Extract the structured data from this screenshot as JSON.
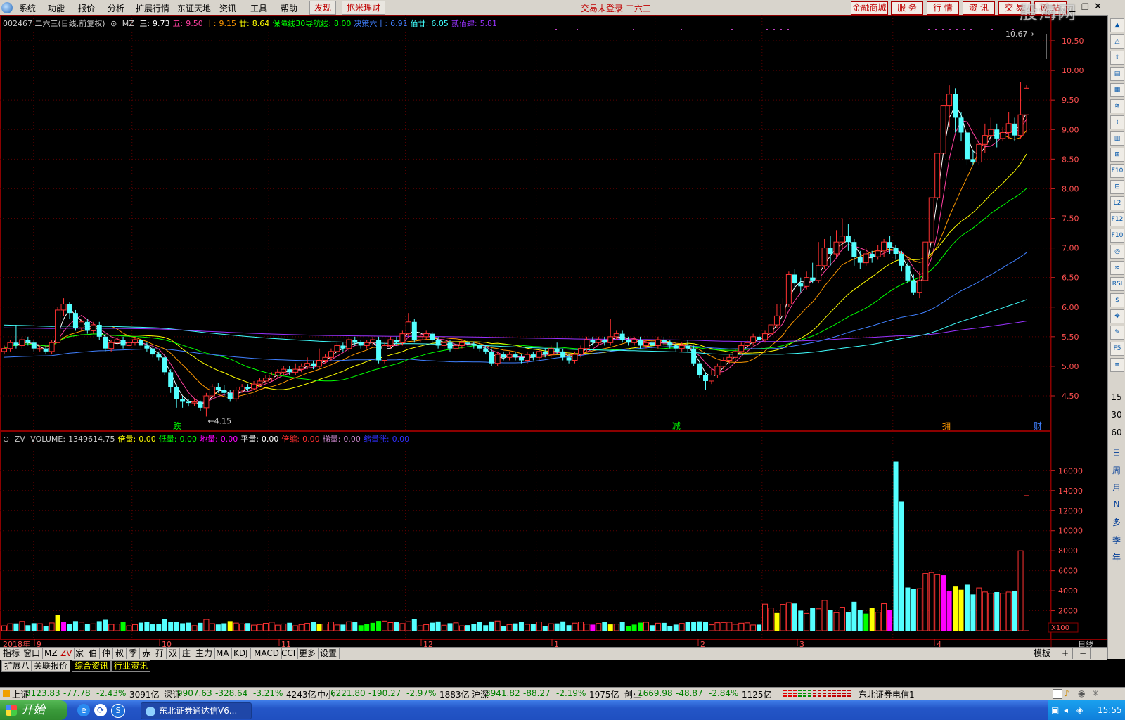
{
  "menubar": {
    "items": [
      "系统",
      "功能",
      "报价",
      "分析",
      "扩展行情",
      "东证天地",
      "资讯",
      "工具",
      "帮助"
    ],
    "highlight_items": [
      "发现",
      "抱米理财"
    ],
    "center_text": "交易未登录  二六三",
    "right_buttons": [
      "金融商城",
      "服 务",
      "行 情",
      "资 讯",
      "交 易",
      "网 站"
    ],
    "watermark": "股海网"
  },
  "price_info": {
    "code_name": "002467 二六三(日线,前复权)",
    "mz_label": "MZ",
    "items": [
      {
        "label": "三:",
        "value": "9.73",
        "color": "#ffffff"
      },
      {
        "label": "五:",
        "value": "9.50",
        "color": "#ff40a0"
      },
      {
        "label": "十:",
        "value": "9.15",
        "color": "#ff9900"
      },
      {
        "label": "廿:",
        "value": "8.64",
        "color": "#ffff00"
      },
      {
        "label": "保障线30导航线:",
        "value": "8.00",
        "color": "#00ff00"
      },
      {
        "label": "决策六十:",
        "value": "6.91",
        "color": "#4080ff"
      },
      {
        "label": "佰廿:",
        "value": "6.05",
        "color": "#40ffff"
      },
      {
        "label": "贰佰肆:",
        "value": "5.81",
        "color": "#9933ff"
      }
    ]
  },
  "volume_info": {
    "indicator": "ZV",
    "items": [
      {
        "label": "VOLUME:",
        "value": "1349614.75",
        "color": "#cccccc"
      },
      {
        "label": "倍量:",
        "value": "0.00",
        "color": "#ffff00"
      },
      {
        "label": "低量:",
        "value": "0.00",
        "color": "#00ff00"
      },
      {
        "label": "地量:",
        "value": "0.00",
        "color": "#ff00ff"
      },
      {
        "label": "平量:",
        "value": "0.00",
        "color": "#ffffff"
      },
      {
        "label": "倍缩:",
        "value": "0.00",
        "color": "#ff3030"
      },
      {
        "label": "梯量:",
        "value": "0.00",
        "color": "#c080c0"
      },
      {
        "label": "缩量涨:",
        "value": "0.00",
        "color": "#3030ff"
      }
    ]
  },
  "markers": {
    "low_label": "←4.15",
    "high_label": "10.67→",
    "signals": [
      "跌",
      "减",
      "拥",
      "财"
    ]
  },
  "x_axis": {
    "year_label": "2018年",
    "months": [
      "9",
      "10",
      "11",
      "12",
      "1",
      "2",
      "3",
      "4"
    ],
    "period": "日线"
  },
  "chart_data": {
    "type": "candlestick",
    "price_axis": {
      "ylim": [
        4.15,
        10.67
      ],
      "ticks": [
        "10.50",
        "10.00",
        "9.50",
        "9.00",
        "8.50",
        "8.00",
        "7.50",
        "7.00",
        "6.50",
        "6.00",
        "5.50",
        "5.00",
        "4.50"
      ]
    },
    "volume_axis": {
      "ylim": [
        0,
        17500
      ],
      "ticks": [
        "16000",
        "14000",
        "12000",
        "10000",
        "8000",
        "6000",
        "4000",
        "2000"
      ],
      "unit": "X100"
    },
    "candles": [
      [
        5.25,
        5.3,
        5.35,
        5.2
      ],
      [
        5.3,
        5.4,
        5.45,
        5.25
      ],
      [
        5.4,
        5.35,
        5.7,
        5.3
      ],
      [
        5.35,
        5.45,
        5.5,
        5.3
      ],
      [
        5.45,
        5.4,
        5.5,
        5.35
      ],
      [
        5.4,
        5.3,
        5.45,
        5.25
      ],
      [
        5.3,
        5.3,
        5.35,
        5.25
      ],
      [
        5.3,
        5.25,
        5.35,
        5.2
      ],
      [
        5.25,
        5.4,
        5.45,
        5.2
      ],
      [
        5.4,
        5.95,
        6.0,
        5.4
      ],
      [
        5.95,
        6.05,
        6.15,
        5.85
      ],
      [
        6.05,
        5.9,
        6.08,
        5.8
      ],
      [
        5.9,
        5.65,
        5.95,
        5.6
      ],
      [
        5.65,
        5.75,
        5.8,
        5.6
      ],
      [
        5.75,
        5.6,
        5.8,
        5.55
      ],
      [
        5.6,
        5.7,
        5.75,
        5.55
      ],
      [
        5.7,
        5.5,
        5.75,
        5.45
      ],
      [
        5.5,
        5.3,
        5.55,
        5.25
      ],
      [
        5.3,
        5.4,
        5.45,
        5.25
      ],
      [
        5.4,
        5.45,
        5.5,
        5.35
      ],
      [
        5.45,
        5.35,
        5.5,
        5.3
      ],
      [
        5.35,
        5.4,
        5.45,
        5.3
      ],
      [
        5.4,
        5.45,
        5.5,
        5.35
      ],
      [
        5.45,
        5.35,
        5.5,
        5.3
      ],
      [
        5.35,
        5.3,
        5.4,
        5.25
      ],
      [
        5.3,
        5.2,
        5.35,
        5.15
      ],
      [
        5.2,
        5.15,
        5.25,
        5.1
      ],
      [
        5.15,
        4.9,
        5.2,
        4.85
      ],
      [
        4.9,
        4.65,
        4.95,
        4.55
      ],
      [
        4.65,
        4.45,
        4.7,
        4.3
      ],
      [
        4.45,
        4.4,
        4.5,
        4.3
      ],
      [
        4.4,
        4.38,
        4.45,
        4.32
      ],
      [
        4.38,
        4.4,
        4.45,
        4.33
      ],
      [
        4.4,
        4.3,
        4.42,
        4.25
      ],
      [
        4.3,
        4.5,
        4.55,
        4.15
      ],
      [
        4.5,
        4.65,
        4.7,
        4.45
      ],
      [
        4.65,
        4.6,
        4.72,
        4.55
      ],
      [
        4.6,
        4.55,
        4.68,
        4.5
      ],
      [
        4.55,
        4.45,
        4.6,
        4.4
      ],
      [
        4.45,
        4.6,
        4.65,
        4.4
      ],
      [
        4.6,
        4.65,
        4.7,
        4.55
      ],
      [
        4.65,
        4.62,
        4.7,
        4.58
      ],
      [
        4.62,
        4.7,
        4.75,
        4.6
      ],
      [
        4.7,
        4.75,
        4.8,
        4.65
      ],
      [
        4.75,
        4.8,
        4.85,
        4.7
      ],
      [
        4.8,
        4.85,
        4.9,
        4.75
      ],
      [
        4.85,
        4.9,
        4.95,
        4.8
      ],
      [
        4.9,
        4.95,
        5.0,
        4.85
      ],
      [
        4.95,
        4.9,
        5.0,
        4.85
      ],
      [
        4.9,
        4.95,
        5.05,
        4.85
      ],
      [
        4.95,
        5.0,
        5.05,
        4.9
      ],
      [
        5.0,
        5.05,
        5.15,
        4.95
      ],
      [
        5.05,
        5.0,
        5.1,
        4.95
      ],
      [
        5.0,
        5.1,
        5.3,
        4.95
      ],
      [
        5.1,
        5.15,
        5.2,
        5.05
      ],
      [
        5.15,
        5.25,
        5.3,
        5.1
      ],
      [
        5.25,
        5.35,
        5.4,
        5.2
      ],
      [
        5.35,
        5.3,
        5.4,
        5.25
      ],
      [
        5.3,
        5.45,
        5.5,
        5.25
      ],
      [
        5.45,
        5.4,
        5.5,
        5.35
      ],
      [
        5.4,
        5.35,
        5.45,
        5.3
      ],
      [
        5.35,
        5.4,
        5.45,
        5.3
      ],
      [
        5.4,
        5.45,
        5.5,
        5.35
      ],
      [
        5.45,
        5.1,
        5.5,
        5.05
      ],
      [
        5.1,
        5.35,
        5.4,
        5.05
      ],
      [
        5.35,
        5.45,
        5.5,
        5.3
      ],
      [
        5.45,
        5.4,
        5.5,
        5.35
      ],
      [
        5.4,
        5.55,
        5.6,
        5.35
      ],
      [
        5.55,
        5.75,
        5.9,
        5.5
      ],
      [
        5.75,
        5.45,
        5.8,
        5.4
      ],
      [
        5.45,
        5.5,
        5.55,
        5.4
      ],
      [
        5.5,
        5.55,
        5.6,
        5.45
      ],
      [
        5.55,
        5.45,
        5.58,
        5.4
      ],
      [
        5.45,
        5.35,
        5.5,
        5.3
      ],
      [
        5.35,
        5.4,
        5.45,
        5.3
      ],
      [
        5.4,
        5.3,
        5.45,
        5.25
      ],
      [
        5.3,
        5.35,
        5.4,
        5.25
      ],
      [
        5.35,
        5.4,
        5.45,
        5.3
      ],
      [
        5.4,
        5.38,
        5.45,
        5.32
      ],
      [
        5.38,
        5.36,
        5.42,
        5.3
      ],
      [
        5.36,
        5.3,
        5.4,
        5.25
      ],
      [
        5.3,
        5.25,
        5.35,
        5.2
      ],
      [
        5.25,
        5.05,
        5.3,
        5.0
      ],
      [
        5.05,
        5.2,
        5.25,
        5.0
      ],
      [
        5.2,
        5.15,
        5.25,
        5.1
      ],
      [
        5.15,
        5.2,
        5.25,
        5.1
      ],
      [
        5.2,
        5.15,
        5.25,
        5.1
      ],
      [
        5.15,
        5.1,
        5.2,
        5.05
      ],
      [
        5.1,
        5.2,
        5.25,
        5.05
      ],
      [
        5.2,
        5.15,
        5.25,
        5.1
      ],
      [
        5.15,
        5.25,
        5.3,
        5.1
      ],
      [
        5.25,
        5.2,
        5.3,
        5.15
      ],
      [
        5.2,
        5.3,
        5.35,
        5.15
      ],
      [
        5.3,
        5.25,
        5.4,
        5.2
      ],
      [
        5.25,
        5.15,
        5.3,
        5.1
      ],
      [
        5.15,
        5.1,
        5.2,
        5.05
      ],
      [
        5.1,
        5.2,
        5.25,
        5.05
      ],
      [
        5.2,
        5.3,
        5.35,
        5.15
      ],
      [
        5.3,
        5.45,
        5.5,
        5.25
      ],
      [
        5.45,
        5.4,
        5.5,
        5.35
      ],
      [
        5.4,
        5.45,
        5.5,
        5.35
      ],
      [
        5.45,
        5.4,
        5.5,
        5.35
      ],
      [
        5.4,
        5.5,
        5.8,
        5.35
      ],
      [
        5.5,
        5.55,
        5.6,
        5.45
      ],
      [
        5.55,
        5.45,
        5.6,
        5.4
      ],
      [
        5.45,
        5.4,
        5.5,
        5.35
      ],
      [
        5.4,
        5.45,
        5.5,
        5.35
      ],
      [
        5.45,
        5.35,
        5.5,
        5.3
      ],
      [
        5.35,
        5.4,
        5.45,
        5.3
      ],
      [
        5.4,
        5.35,
        5.45,
        5.3
      ],
      [
        5.35,
        5.45,
        5.5,
        5.3
      ],
      [
        5.45,
        5.4,
        5.5,
        5.35
      ],
      [
        5.4,
        5.35,
        5.45,
        5.3
      ],
      [
        5.35,
        5.3,
        5.4,
        5.25
      ],
      [
        5.3,
        5.35,
        5.4,
        5.25
      ],
      [
        5.35,
        5.3,
        5.45,
        5.25
      ],
      [
        5.3,
        5.05,
        5.35,
        5.0
      ],
      [
        5.05,
        4.85,
        5.1,
        4.8
      ],
      [
        4.85,
        4.75,
        4.9,
        4.6
      ],
      [
        4.75,
        4.85,
        4.95,
        4.7
      ],
      [
        4.85,
        5.0,
        5.05,
        4.8
      ],
      [
        5.0,
        5.1,
        5.15,
        4.95
      ],
      [
        5.1,
        5.15,
        5.2,
        5.05
      ],
      [
        5.15,
        5.25,
        5.3,
        5.1
      ],
      [
        5.25,
        5.35,
        5.4,
        5.2
      ],
      [
        5.35,
        5.4,
        5.45,
        5.3
      ],
      [
        5.4,
        5.5,
        5.55,
        5.35
      ],
      [
        5.5,
        5.45,
        5.55,
        5.4
      ],
      [
        5.45,
        5.55,
        5.6,
        5.4
      ],
      [
        5.55,
        5.7,
        5.8,
        5.5
      ],
      [
        5.7,
        5.85,
        6.05,
        5.65
      ],
      [
        5.85,
        6.05,
        6.15,
        5.8
      ],
      [
        6.05,
        6.55,
        6.6,
        6.0
      ],
      [
        6.55,
        6.4,
        6.65,
        6.3
      ],
      [
        6.4,
        6.35,
        6.5,
        6.25
      ],
      [
        6.35,
        6.5,
        6.6,
        6.3
      ],
      [
        6.5,
        6.45,
        6.75,
        6.4
      ],
      [
        6.45,
        6.7,
        7.1,
        6.4
      ],
      [
        6.7,
        7.0,
        7.15,
        6.65
      ],
      [
        7.0,
        6.9,
        7.2,
        6.7
      ],
      [
        6.9,
        7.1,
        7.3,
        6.85
      ],
      [
        7.1,
        7.2,
        7.5,
        7.0
      ],
      [
        7.2,
        7.1,
        7.4,
        6.95
      ],
      [
        7.1,
        6.85,
        7.15,
        6.7
      ],
      [
        6.85,
        6.75,
        6.95,
        6.65
      ],
      [
        6.75,
        6.9,
        7.0,
        6.7
      ],
      [
        6.9,
        6.85,
        6.95,
        6.75
      ],
      [
        6.85,
        6.95,
        7.05,
        6.8
      ],
      [
        6.95,
        7.1,
        7.15,
        6.85
      ],
      [
        7.1,
        7.0,
        7.2,
        6.9
      ],
      [
        7.0,
        6.9,
        7.05,
        6.8
      ],
      [
        6.9,
        6.7,
        6.95,
        6.6
      ],
      [
        6.7,
        6.45,
        6.75,
        6.4
      ],
      [
        6.45,
        6.25,
        6.55,
        6.2
      ],
      [
        6.25,
        6.45,
        6.6,
        6.15
      ],
      [
        6.45,
        7.1,
        7.1,
        6.45
      ],
      [
        7.1,
        7.85,
        7.85,
        7.1
      ],
      [
        7.85,
        8.6,
        8.6,
        7.85
      ],
      [
        8.6,
        9.4,
        9.4,
        8.6
      ],
      [
        9.4,
        9.6,
        9.75,
        9.05
      ],
      [
        9.6,
        9.2,
        9.7,
        8.95
      ],
      [
        9.2,
        8.95,
        9.3,
        8.8
      ],
      [
        8.95,
        8.5,
        9.0,
        8.4
      ],
      [
        8.5,
        8.45,
        8.65,
        8.4
      ],
      [
        8.45,
        8.75,
        8.85,
        8.4
      ],
      [
        8.75,
        8.9,
        9.1,
        8.6
      ],
      [
        8.9,
        9.0,
        9.2,
        8.8
      ],
      [
        9.0,
        8.85,
        9.1,
        8.7
      ],
      [
        8.85,
        8.95,
        9.05,
        8.8
      ],
      [
        8.95,
        9.1,
        9.3,
        8.85
      ],
      [
        9.1,
        8.9,
        9.2,
        8.8
      ],
      [
        8.9,
        9.25,
        9.8,
        8.85
      ],
      [
        9.25,
        9.7,
        9.75,
        8.95
      ]
    ],
    "volume_colors": "cyan for bearish days, red outline for bullish days, yellow/magenta/green flags from indicator",
    "moving_averages": [
      {
        "name": "三",
        "color": "#ffffff"
      },
      {
        "name": "五",
        "color": "#ff40a0"
      },
      {
        "name": "十",
        "color": "#ff9900"
      },
      {
        "name": "廿",
        "color": "#ffff00"
      },
      {
        "name": "保障线30导航线",
        "color": "#00ff00"
      },
      {
        "name": "决策六十",
        "color": "#4080ff"
      },
      {
        "name": "佰廿",
        "color": "#40ffff"
      },
      {
        "name": "贰佰肆",
        "color": "#9933ff"
      }
    ]
  },
  "bottom_tabs": [
    "指标",
    "窗口",
    "MZ",
    "ZV",
    "家",
    "伯",
    "仲",
    "叔",
    "季",
    "赤",
    "孖",
    "双",
    "庄",
    "主力",
    "MA",
    "KDJ",
    "MACD",
    "CCI",
    "更多",
    "设置"
  ],
  "bottom_right_tabs": [
    "模板",
    "+",
    "−"
  ],
  "info_tabs": [
    "扩展八",
    "关联报价",
    "综合资讯",
    "行业资讯"
  ],
  "right_toolbar_periods": [
    "15",
    "30",
    "60",
    "日",
    "周",
    "月",
    "N",
    "多",
    "季",
    "年"
  ],
  "status": [
    {
      "name": "上证",
      "value": "3123.83",
      "change": "-77.78",
      "pct": "-2.43%",
      "amount": "3091亿"
    },
    {
      "name": "深证",
      "value": "9907.63",
      "change": "-328.64",
      "pct": "-3.21%",
      "amount": "4243亿"
    },
    {
      "name": "中小",
      "value": "6221.80",
      "change": "-190.27",
      "pct": "-2.97%",
      "amount": "1883亿"
    },
    {
      "name": "沪深",
      "value": "3941.82",
      "change": "-88.27",
      "pct": "-2.19%",
      "amount": "1975亿"
    },
    {
      "name": "创业",
      "value": "1669.98",
      "change": "-48.87",
      "pct": "-2.84%",
      "amount": "1125亿"
    }
  ],
  "broker": "东北证券电信1",
  "taskbar": {
    "start": "开始",
    "app": "东北证券通达信V6...",
    "time": "15:55"
  }
}
